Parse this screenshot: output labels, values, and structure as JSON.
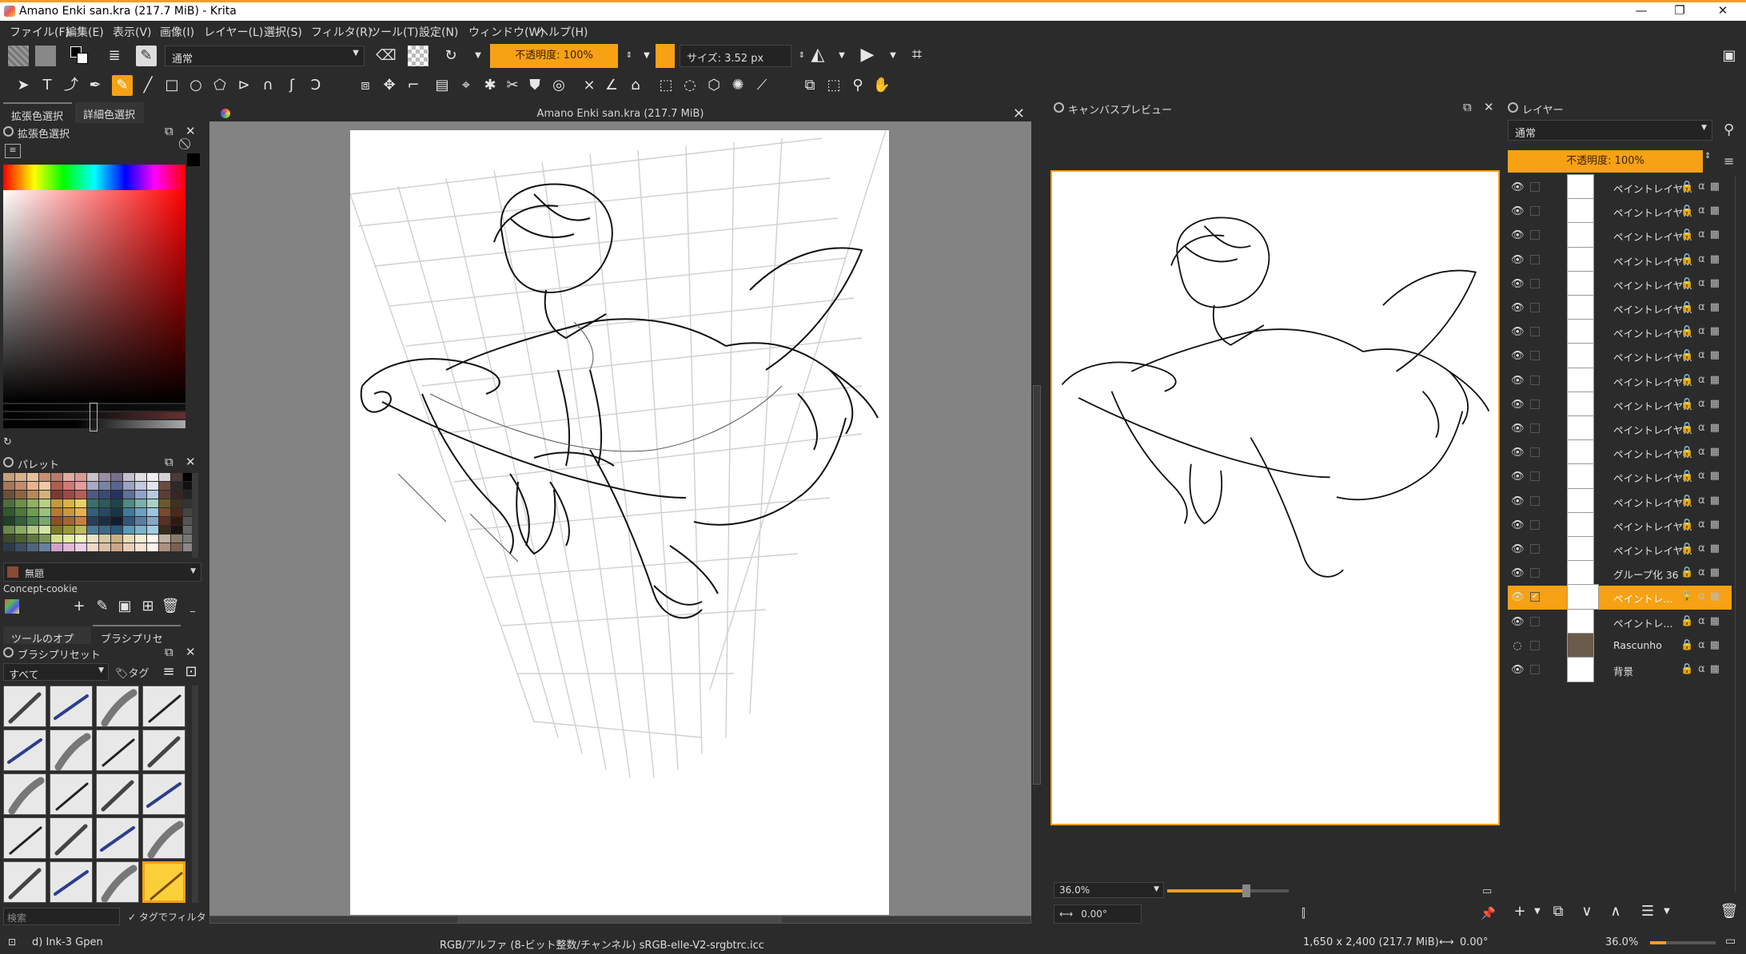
{
  "window": {
    "title": "Amano Enki san.kra (217.7 MiB)  - Krita",
    "minimize": "—",
    "maximize": "❐",
    "close": "✕"
  },
  "menu": [
    "ファイル(F)",
    "編集(E)",
    "表示(V)",
    "画像(I)",
    "レイヤー(L)",
    "選択(S)",
    "フィルタ(R)",
    "ツール(T)",
    "設定(N)",
    "ウィンドウ(W)",
    "ヘルプ(H)"
  ],
  "toolbar": {
    "blend_mode": "通常",
    "opacity_label": "不透明度: 100%",
    "size_label": "サイズ: 3.52 px"
  },
  "left_tabs": {
    "tab1": "拡張色選択",
    "tab2": "詳細色選択"
  },
  "color_selector": {
    "title": "拡張色選択"
  },
  "palette_panel": {
    "title": "パレット",
    "color_name": "無題",
    "palette_name": "Concept-cookie"
  },
  "options_tabs": {
    "tab1": "ツールのオプション",
    "tab2": "ブラシプリセット"
  },
  "brush_presets": {
    "title": "ブラシプリセット",
    "filter_all": "すべて",
    "tag_label": "タグ",
    "search_placeholder": "検索",
    "tag_filter_label": "タグでフィルタ"
  },
  "document": {
    "title": "Amano Enki san.kra (217.7 MiB)"
  },
  "canvas_preview": {
    "title": "キャンバスプレビュー",
    "zoom": "36.0%",
    "rotation": "0.00°"
  },
  "layers_panel": {
    "title": "レイヤー",
    "blend_mode": "通常",
    "opacity_label": "不透明度: 100%",
    "layers": [
      {
        "name": "ペイントレイヤ...",
        "visible": true,
        "selected": false
      },
      {
        "name": "ペイントレイヤ...",
        "visible": true,
        "selected": false
      },
      {
        "name": "ペイントレイヤ...",
        "visible": true,
        "selected": false
      },
      {
        "name": "ペイントレイヤ...",
        "visible": true,
        "selected": false
      },
      {
        "name": "ペイントレイヤ...",
        "visible": true,
        "selected": false
      },
      {
        "name": "ペイントレイヤ...",
        "visible": true,
        "selected": false
      },
      {
        "name": "ペイントレイヤ...",
        "visible": true,
        "selected": false
      },
      {
        "name": "ペイントレイヤ...",
        "visible": true,
        "selected": false
      },
      {
        "name": "ペイントレイヤ...",
        "visible": true,
        "selected": false
      },
      {
        "name": "ペイントレイヤ...",
        "visible": true,
        "selected": false
      },
      {
        "name": "ペイントレイヤ...",
        "visible": true,
        "selected": false
      },
      {
        "name": "ペイントレイヤ...",
        "visible": true,
        "selected": false
      },
      {
        "name": "ペイントレイヤ...",
        "visible": true,
        "selected": false
      },
      {
        "name": "ペイントレイヤ...",
        "visible": true,
        "selected": false
      },
      {
        "name": "ペイントレイヤ...",
        "visible": true,
        "selected": false
      },
      {
        "name": "ペイントレイヤ...",
        "visible": true,
        "selected": false
      },
      {
        "name": "グループ化 36",
        "visible": true,
        "selected": false
      },
      {
        "name": "ペイントレ...",
        "visible": true,
        "selected": true
      },
      {
        "name": "ペイントレ...",
        "visible": true,
        "selected": false
      },
      {
        "name": "Rascunho",
        "visible": false,
        "selected": false
      },
      {
        "name": "背景",
        "visible": true,
        "selected": false
      }
    ]
  },
  "status": {
    "brush_name": "d) Ink-3 Gpen",
    "color_profile": "RGB/アルファ (8-ビット整数/チャンネル)  sRGB-elle-V2-srgbtrc.icc",
    "image_size": "1,650 x 2,400 (217.7 MiB)",
    "rotation": "0.00°",
    "zoom": "36.0%"
  },
  "colors": {
    "accent": "#f7a115",
    "panel_bg": "#2b2b2b",
    "canvas_bg": "#838383"
  }
}
